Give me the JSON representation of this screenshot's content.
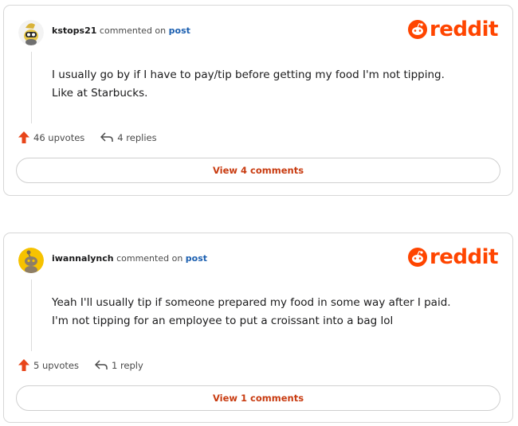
{
  "brand": {
    "wordmark": "reddit",
    "accent": "#ff4500",
    "link_color": "#1b5fb0"
  },
  "comments": [
    {
      "username": "kstops21",
      "action_text": "commented on",
      "target_link": "post",
      "body": "I usually go by if I have to pay/tip before getting my food I'm not tipping. Like at Starbucks.",
      "upvotes": "46 upvotes",
      "replies": "4 replies",
      "view_button": "View 4 comments",
      "avatar_icon": "snoo-avatar-icon"
    },
    {
      "username": "iwannalynch",
      "action_text": "commented on",
      "target_link": "post",
      "body": "Yeah I'll usually tip if someone prepared my food in some way after I paid. I'm not tipping for an employee to put a croissant into a bag lol",
      "upvotes": "5 upvotes",
      "replies": "1 reply",
      "view_button": "View 1 comments",
      "avatar_icon": "snoo-avatar-icon"
    }
  ]
}
